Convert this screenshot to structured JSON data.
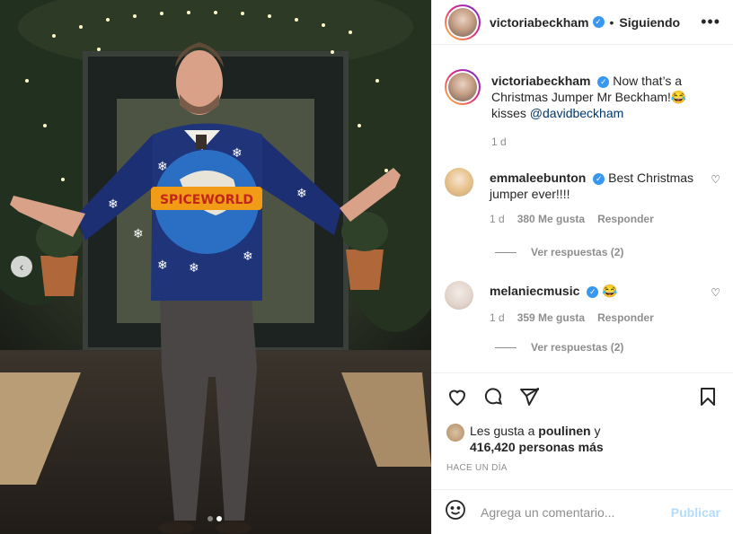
{
  "post": {
    "username": "victoriabeckham",
    "follow_label": "Siguiendo",
    "more_label": "•••",
    "caption": "Now that’s a Christmas Jumper Mr Beckham!😂 kisses ",
    "caption_mention": "@davidbeckham",
    "caption_time": "1 d",
    "sweater_text": "SPICEWORLD"
  },
  "comments": [
    {
      "username": "emmaleebunton",
      "text": "Best Christmas jumper ever!!!!",
      "time": "1 d",
      "likes": "380 Me gusta",
      "reply": "Responder",
      "replies": "Ver respuestas (2)"
    },
    {
      "username": "melaniecmusic",
      "text": "😂",
      "time": "1 d",
      "likes": "359 Me gusta",
      "reply": "Responder",
      "replies": "Ver respuestas (2)"
    }
  ],
  "likes": {
    "prefix": "Les gusta a ",
    "user": "poulinen",
    "suffix": " y",
    "count": "416,420 personas más"
  },
  "time_ago": "HACE UN DÍA",
  "add_comment": {
    "placeholder": "Agrega un comentario...",
    "publish": "Publicar"
  },
  "carousel": {
    "total": 2,
    "active": 2
  }
}
